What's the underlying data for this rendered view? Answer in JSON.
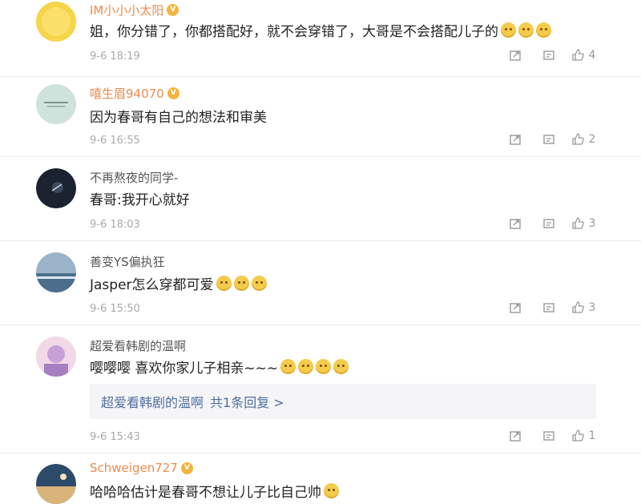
{
  "comments": [
    {
      "username": "IM小小小太阳",
      "vip": true,
      "text": "姐，你分错了，你都搭配好，就不会穿错了，大哥是不会搭配儿子的",
      "emoji_count": 3,
      "time": "9-6 18:19",
      "likes": "4",
      "avatar_colors": [
        "#f6d548",
        "#f9e06b"
      ]
    },
    {
      "username": "嘻生眉94070",
      "vip": true,
      "text": "因为春哥有自己的想法和审美",
      "emoji_count": 0,
      "time": "9-6 16:55",
      "likes": "2",
      "avatar_colors": [
        "#cfe3dd",
        "#a9c8c0"
      ]
    },
    {
      "username": "不再熬夜的同学-",
      "vip": false,
      "text": "春哥:我开心就好",
      "emoji_count": 0,
      "time": "9-6 18:03",
      "likes": "3",
      "avatar_colors": [
        "#1b2230",
        "#3a4a5c"
      ]
    },
    {
      "username": "善变YS偏执狂",
      "vip": false,
      "text": "Jasper怎么穿都可爱",
      "emoji_count": 3,
      "time": "9-6 15:50",
      "likes": "3",
      "avatar_colors": [
        "#4c6d8c",
        "#9ab3c8"
      ]
    },
    {
      "username": "超爱看韩剧的温啊",
      "vip": false,
      "text": "嘤嘤嘤 喜欢你家儿子相亲~~~",
      "emoji_count": 4,
      "time": "9-6 15:43",
      "likes": "1",
      "avatar_colors": [
        "#c8a0d8",
        "#f3d8e8"
      ],
      "reply": {
        "author": "超爱看韩剧的温啊",
        "summary": "共1条回复 >"
      }
    },
    {
      "username": "Schweigen727",
      "vip": true,
      "text": "哈哈哈估计是春哥不想让儿子比自己帅",
      "emoji_count": 1,
      "time": "",
      "likes": "",
      "avatar_colors": [
        "#2d4a6a",
        "#d8b47a"
      ]
    }
  ]
}
